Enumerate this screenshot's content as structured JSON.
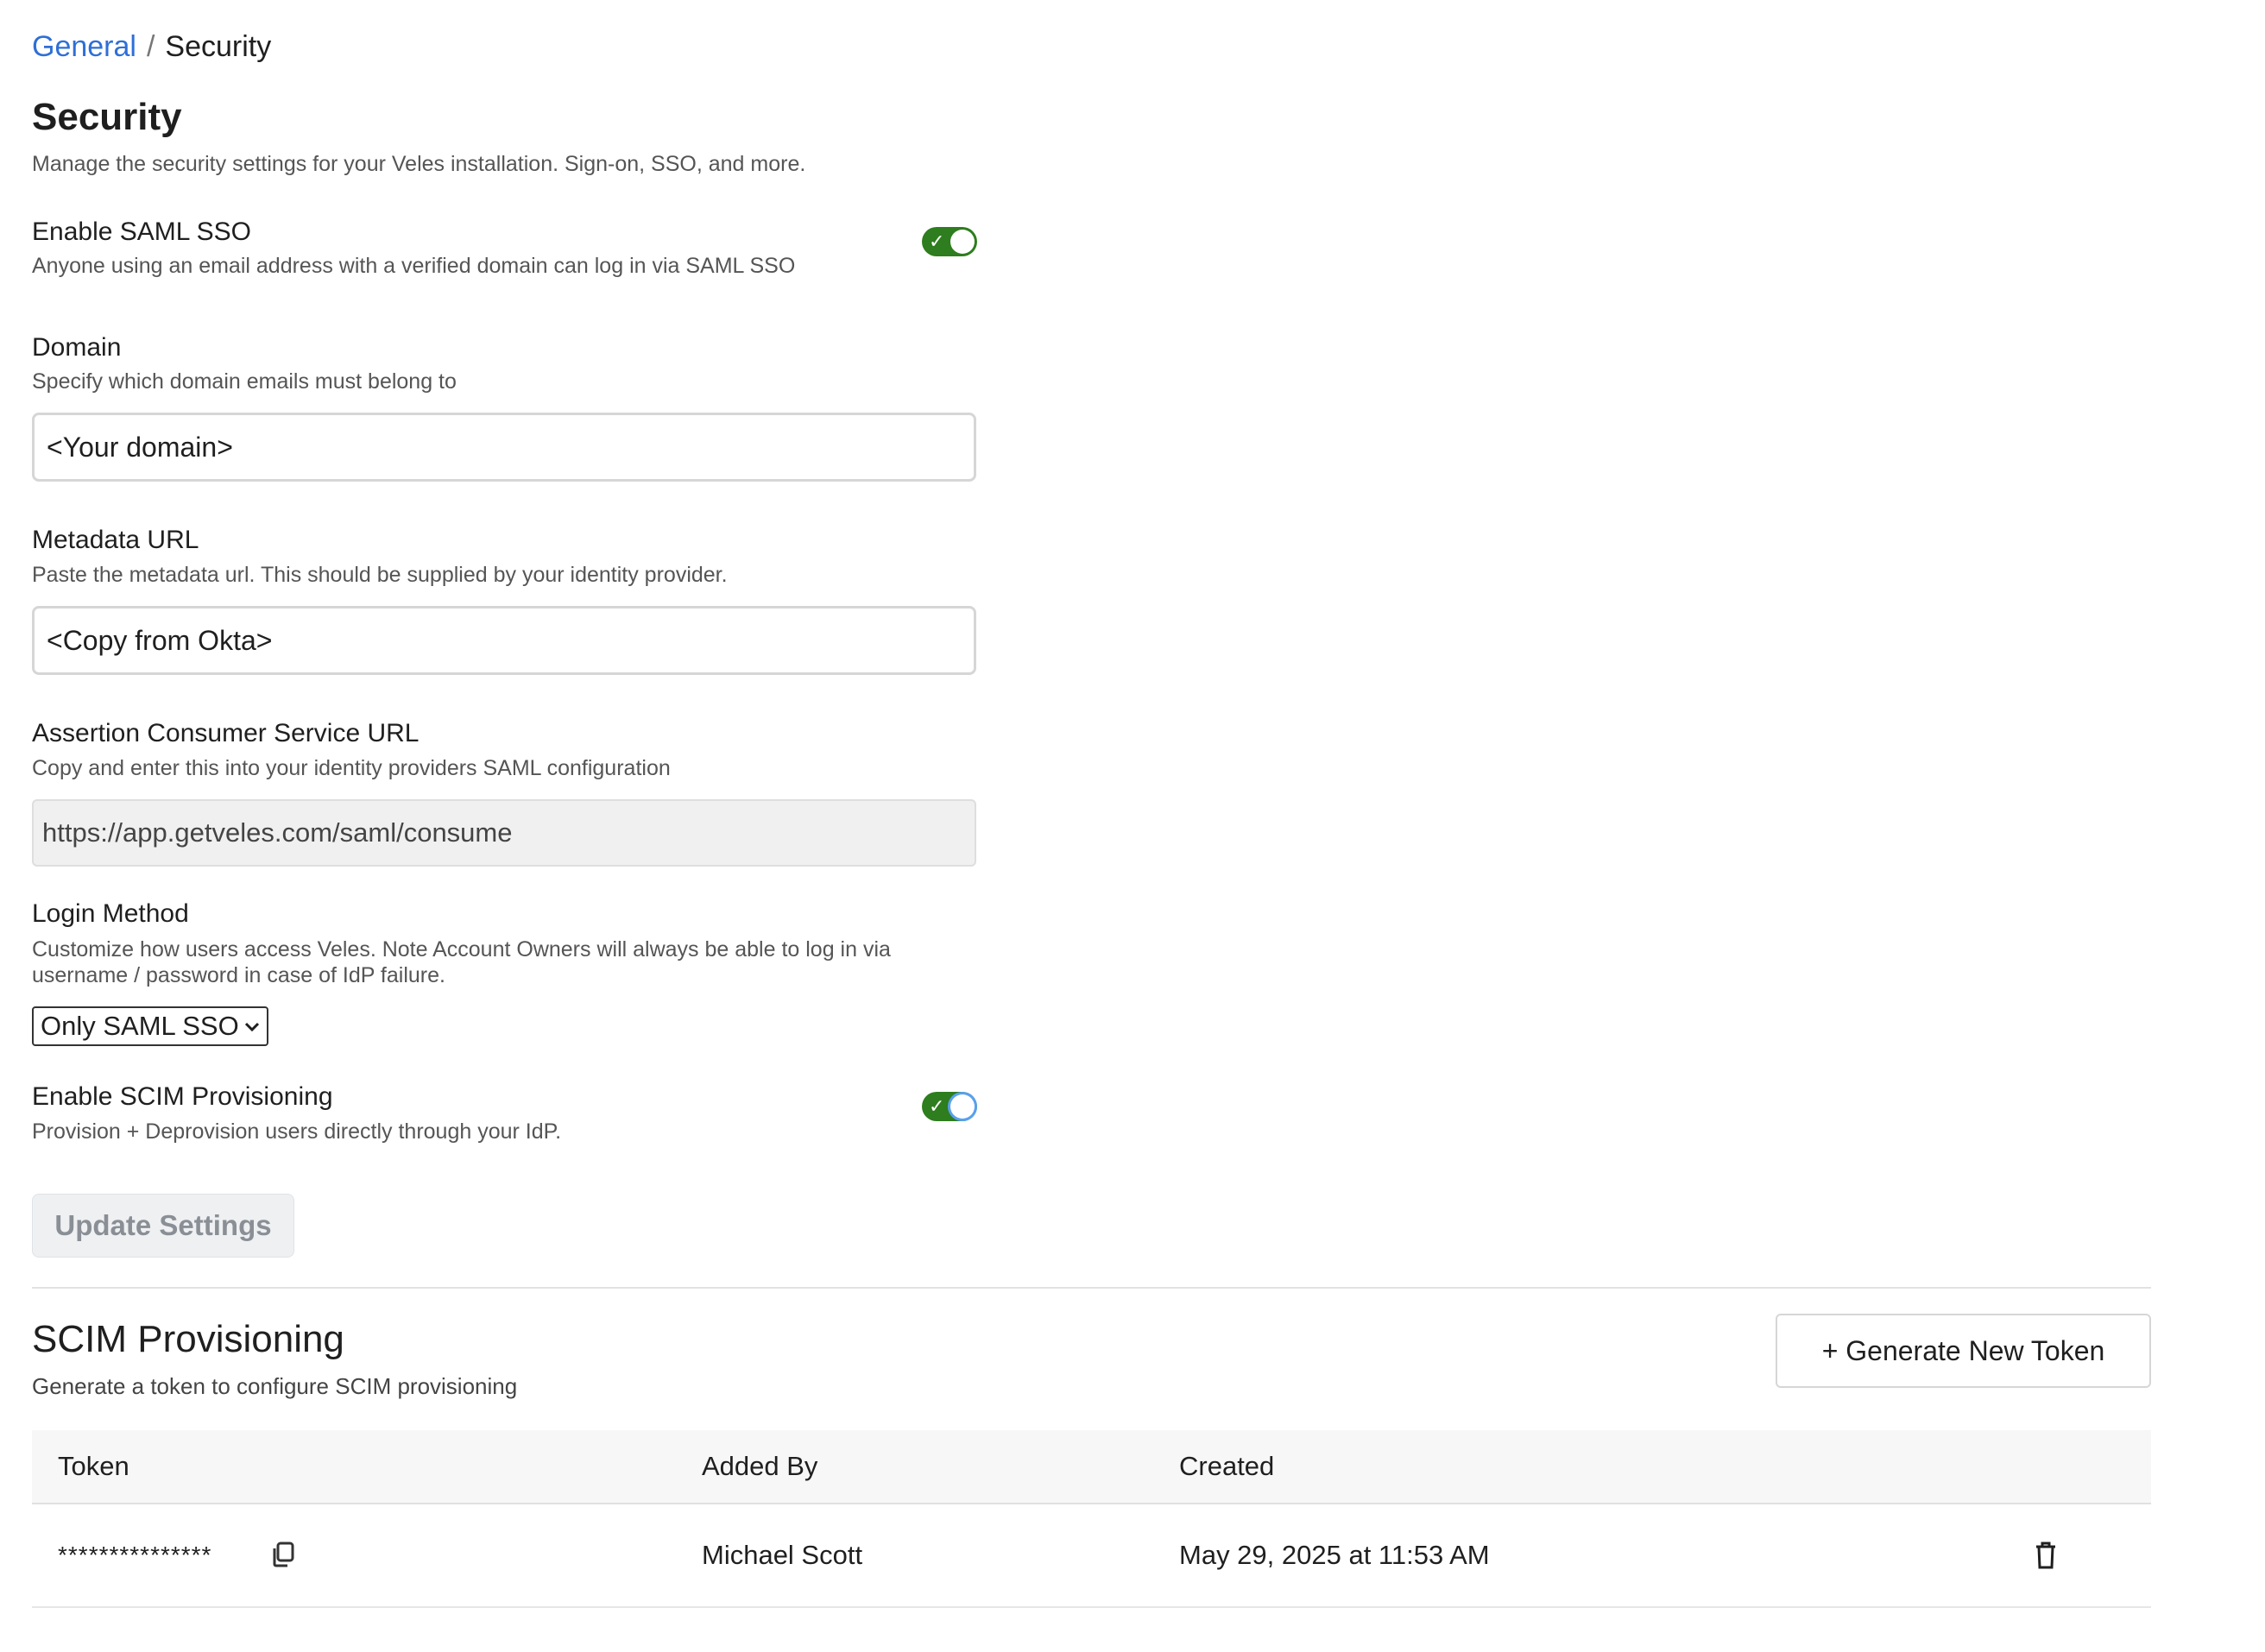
{
  "breadcrumb": {
    "parent": "General",
    "separator": "/",
    "current": "Security"
  },
  "page": {
    "title": "Security",
    "description": "Manage the security settings for your Veles installation. Sign-on, SSO, and more."
  },
  "saml": {
    "label": "Enable SAML SSO",
    "help": "Anyone using an email address with a verified domain can log in via SAML SSO",
    "enabled": true
  },
  "domain": {
    "label": "Domain",
    "help": "Specify which domain emails must belong to",
    "value": "",
    "placeholder": "<Your domain>"
  },
  "metadata": {
    "label": "Metadata URL",
    "help": "Paste the metadata url. This should be supplied by your identity provider.",
    "value": "",
    "placeholder": "<Copy from Okta>"
  },
  "acs": {
    "label": "Assertion Consumer Service URL",
    "help": "Copy and enter this into your identity providers SAML configuration",
    "value": "https://app.getveles.com/saml/consume"
  },
  "login_method": {
    "label": "Login Method",
    "help_line1": "Customize how users access Veles. Note Account Owners will always be able to log in via",
    "help_line2": "username / password in case of IdP failure.",
    "selected": "Only SAML SSO"
  },
  "scim": {
    "label": "Enable SCIM Provisioning",
    "help": "Provision + Deprovision users directly through your IdP.",
    "enabled": true
  },
  "update_button": "Update Settings",
  "scim_section": {
    "title": "SCIM Provisioning",
    "description": "Generate a token to configure SCIM provisioning",
    "generate_button": "+ Generate New Token",
    "columns": {
      "token": "Token",
      "added_by": "Added By",
      "created": "Created"
    },
    "rows": [
      {
        "token": "***************",
        "added_by": "Michael Scott",
        "created": "May 29, 2025 at 11:53 AM"
      }
    ]
  },
  "icons": {
    "toggle_check": "check-icon",
    "select_chevron": "chevron-down-icon",
    "copy": "copy-icon",
    "delete": "trash-icon"
  },
  "colors": {
    "link": "#2f6fd6",
    "toggle_on": "#2e7d1e",
    "focus_ring": "#5aa0f0",
    "disabled_button_bg": "#eef0f2",
    "disabled_button_text": "#8a8f96"
  }
}
